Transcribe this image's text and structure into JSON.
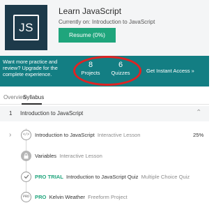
{
  "course": {
    "logo_text": "JS",
    "title": "Learn JavaScript",
    "current_on": "Currently on: Introduction to JavaScript",
    "resume_label": "Resume (0%)"
  },
  "promo": {
    "text": "Want more practice and review? Upgrade for the complete experience.",
    "projects_count": "8",
    "projects_label": "Projects",
    "quizzes_count": "6",
    "quizzes_label": "Quizzes",
    "cta": "Get Instant Access »"
  },
  "tabs": [
    {
      "label": "Overview",
      "active": false
    },
    {
      "label": "Syllabus",
      "active": true
    }
  ],
  "section": {
    "number": "1",
    "title": "Introduction to JavaScript"
  },
  "lessons": [
    {
      "icon": "code-icon",
      "tag": "",
      "name": "Introduction to JavaScript",
      "type": "Interactive Lesson",
      "percent": "25%"
    },
    {
      "icon": "lock-icon",
      "tag": "",
      "name": "Variables",
      "type": "Interactive Lesson",
      "percent": ""
    },
    {
      "icon": "quiz-icon",
      "tag": "PRO TRIAL",
      "name": "Introduction to JavaScript Quiz",
      "type": "Multiple Choice Quiz",
      "percent": ""
    },
    {
      "icon": "project-icon",
      "tag": "PRO",
      "name": "Kelvin Weather",
      "type": "Freeform Project",
      "percent": ""
    }
  ],
  "colors": {
    "logo_bg": "#1d3a4a",
    "accent_green": "#1fa57c",
    "banner_teal": "#137e83",
    "highlight_red": "#e02323"
  }
}
